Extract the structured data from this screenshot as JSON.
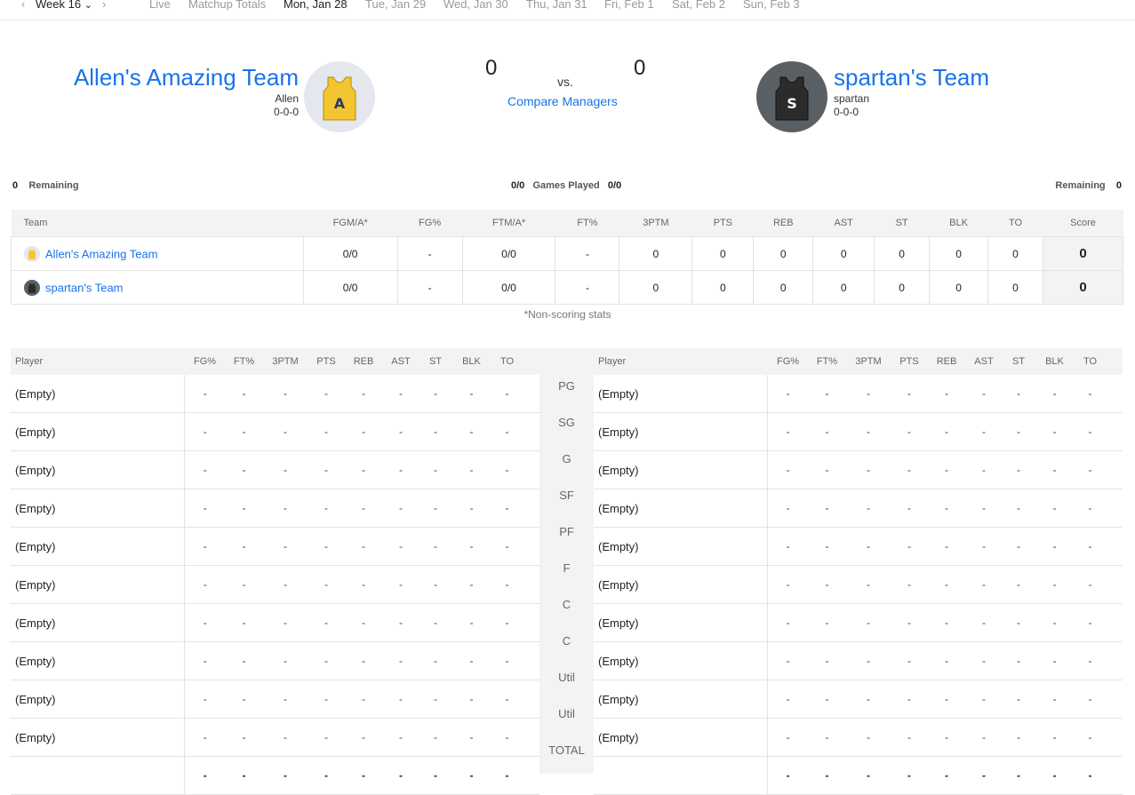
{
  "nav": {
    "prev": "‹",
    "week": "Week 16",
    "week_caret": "⌄",
    "next": "›",
    "tabs": [
      "Live",
      "Matchup Totals",
      "Mon, Jan 28",
      "Tue, Jan 29",
      "Wed, Jan 30",
      "Thu, Jan 31",
      "Fri, Feb 1",
      "Sat, Feb 2",
      "Sun, Feb 3"
    ],
    "active_tab": "Mon, Jan 28"
  },
  "matchup": {
    "left": {
      "name": "Allen's Amazing Team",
      "manager": "Allen",
      "record": "0-0-0",
      "score": "0",
      "jersey_letter": "A",
      "jersey_color": "#f2c531",
      "avatar_bg": "#e4e7ee"
    },
    "right": {
      "name": "spartan's Team",
      "manager": "spartan",
      "record": "0-0-0",
      "score": "0",
      "jersey_letter": "S",
      "jersey_color": "#2b2b2b",
      "avatar_bg": "#5a5f63"
    },
    "vs": "vs.",
    "compare": "Compare Managers"
  },
  "games": {
    "left_remaining_num": "0",
    "left_remaining_label": "Remaining",
    "left_played": "0/0",
    "played_label": "Games Played",
    "right_played": "0/0",
    "right_remaining_label": "Remaining",
    "right_remaining_num": "0"
  },
  "team_table": {
    "headers": [
      "Team",
      "FGM/A*",
      "FG%",
      "FTM/A*",
      "FT%",
      "3PTM",
      "PTS",
      "REB",
      "AST",
      "ST",
      "BLK",
      "TO",
      "Score"
    ],
    "rows": [
      {
        "name": "Allen's Amazing Team",
        "cells": [
          "0/0",
          "-",
          "0/0",
          "-",
          "0",
          "0",
          "0",
          "0",
          "0",
          "0",
          "0"
        ],
        "score": "0"
      },
      {
        "name": "spartan's Team",
        "cells": [
          "0/0",
          "-",
          "0/0",
          "-",
          "0",
          "0",
          "0",
          "0",
          "0",
          "0",
          "0"
        ],
        "score": "0"
      }
    ],
    "footnote": "*Non-scoring stats"
  },
  "player_table": {
    "headers": [
      "Player",
      "FG%",
      "FT%",
      "3PTM",
      "PTS",
      "REB",
      "AST",
      "ST",
      "BLK",
      "TO"
    ],
    "positions": [
      "PG",
      "SG",
      "G",
      "SF",
      "PF",
      "F",
      "C",
      "C",
      "Util",
      "Util",
      "TOTAL"
    ],
    "empty_label": "(Empty)",
    "dash": "-"
  },
  "colors": {
    "link": "#1a73e8",
    "header_bg": "#f3f3f3",
    "border": "#e3e3e3"
  }
}
